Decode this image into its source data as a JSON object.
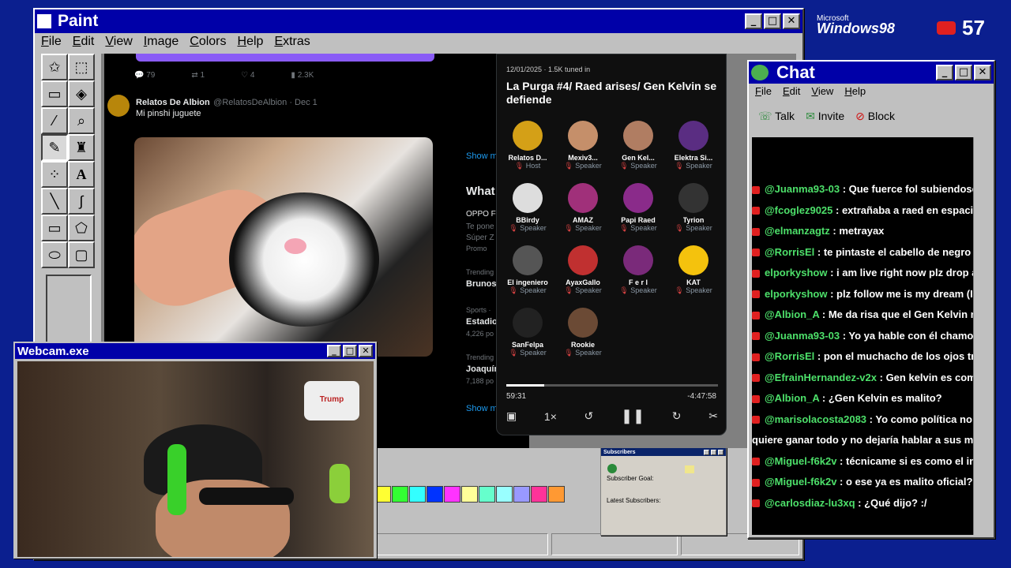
{
  "desktop": {
    "logo_top": "Microsoft",
    "logo_main": "Windows98",
    "yt_count": "57"
  },
  "paint": {
    "title": "Paint",
    "menu": [
      "File",
      "Edit",
      "View",
      "Image",
      "Colors",
      "Help",
      "Extras"
    ],
    "palette": [
      "#ffff33",
      "#33ff33",
      "#33ffff",
      "#0033ff",
      "#ff33ff",
      "#ffff99",
      "#66ffcc",
      "#99ffff",
      "#9999ff",
      "#ff3399",
      "#ff9933"
    ]
  },
  "tweet": {
    "stats": [
      "79",
      "1",
      "4",
      "2.3K"
    ],
    "author": "Relatos De Albion",
    "handle": "@RelatosDeAlbion · Dec 1",
    "text": "Mi pinshi juguete"
  },
  "side": {
    "show_more": "Show m",
    "whats": "What",
    "oppo": "OPPO F",
    "te": "Te pone",
    "super": "Súper Z",
    "promo": "Promo",
    "tr1": "Trending",
    "brunos": "Brunos",
    "sports": "Sports · ",
    "estadio": "Estadio",
    "posts1": "4,226 po",
    "tr2": "Trending",
    "joaquin": "Joaquín",
    "posts2": "7,188 po",
    "show_more2": "Show m"
  },
  "space": {
    "meta": "12/01/2025 · 1.5K tuned in",
    "title": "La Purga #4/ Raed arises/ Gen Kelvin se defiende",
    "speakers": [
      {
        "name": "Relatos D...",
        "role": "Host",
        "color": "#d4a017"
      },
      {
        "name": "Mexiv3...",
        "role": "Speaker",
        "color": "#c58f6a"
      },
      {
        "name": "Gen Kel...",
        "role": "Speaker",
        "color": "#b07d62"
      },
      {
        "name": "Elektra Si...",
        "role": "Speaker",
        "color": "#5a2d82"
      },
      {
        "name": "BBirdy",
        "role": "Speaker",
        "color": "#dddddd"
      },
      {
        "name": "AMAZ",
        "role": "Speaker",
        "color": "#a0307a"
      },
      {
        "name": "Papi Raed",
        "role": "Speaker",
        "color": "#8a2b8a"
      },
      {
        "name": "Tyrion",
        "role": "Speaker",
        "color": "#333333"
      },
      {
        "name": "El ingeniero",
        "role": "Speaker",
        "color": "#555555"
      },
      {
        "name": "AyaxGallo",
        "role": "Speaker",
        "color": "#c03030"
      },
      {
        "name": "F e r l",
        "role": "Speaker",
        "color": "#7a2a7a"
      },
      {
        "name": "KAT",
        "role": "Speaker",
        "color": "#f4c20d"
      },
      {
        "name": "SanFelpa",
        "role": "Speaker",
        "color": "#222222"
      },
      {
        "name": "Rookie",
        "role": "Speaker",
        "color": "#6b4a35"
      }
    ],
    "time_elapsed": "59:31",
    "time_left": "-4:47:58",
    "speed": "1×",
    "progress": 0.18
  },
  "subs": {
    "title": "Subscribers",
    "goal": "Subscriber Goal:",
    "latest": "Latest Subscribers:"
  },
  "chat": {
    "title": "Chat",
    "menu": [
      "File",
      "Edit",
      "View",
      "Help"
    ],
    "talk": "Talk",
    "invite": "Invite",
    "block": "Block",
    "messages": [
      {
        "user": "@Juanma93-03",
        "text": ": Que fuerce fol subiendose a"
      },
      {
        "user": "@fcoglez9025",
        "text": ": extrañaba a raed en espacios jaja"
      },
      {
        "user": "@elmanzagtz",
        "text": ": metrayax"
      },
      {
        "user": "@RorrisEl",
        "text": ": te pintaste el cabello de negro"
      },
      {
        "user": "elporkyshow",
        "text": ": i am live right now plz drop a follow"
      },
      {
        "user": "elporkyshow",
        "text": ": plz follow me is my dream (I AM LI"
      },
      {
        "user": "@Albion_A",
        "text": ": Me da risa que el Gen Kelvin no habla"
      },
      {
        "user": "@Juanma93-03",
        "text": ": Yo ya hable con él chamo"
      },
      {
        "user": "@RorrisEl",
        "text": ": pon el muchacho de los ojos tristes"
      },
      {
        "user": "@EfrainHernandez-v2x",
        "text": ": Gen kelvin es como el m"
      },
      {
        "user": "@Albion_A",
        "text": ": ¿Gen Kelvin es malito?"
      },
      {
        "user": "@marisolacosta2083",
        "text": ": Yo como política no le v"
      },
      {
        "user": "",
        "text": "quiere ganar todo y no dejaría hablar a sus ministros"
      },
      {
        "user": "@Miguel-f6k2v",
        "text": ": técnicame si es como el ingenie"
      },
      {
        "user": "@Miguel-f6k2v",
        "text": ": o ese ya es malito oficial?"
      },
      {
        "user": "@carlosdiaz-lu3xq",
        "text": ": ¿Qué dijo? :/"
      }
    ]
  },
  "webcam": {
    "title": "Webcam.exe",
    "trump": "Trump"
  }
}
